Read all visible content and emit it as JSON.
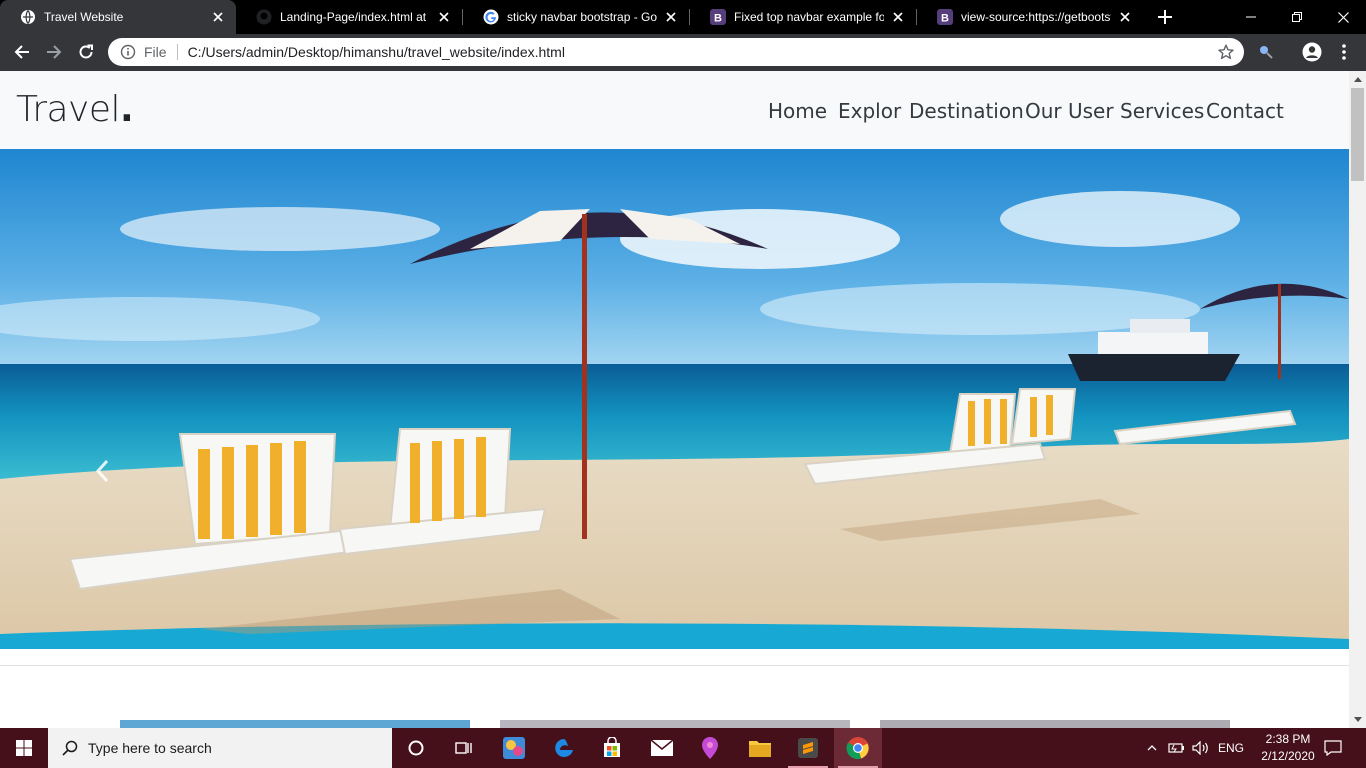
{
  "browser": {
    "tabs": [
      {
        "title": "Travel Website",
        "active": true,
        "favicon": "globe-icon"
      },
      {
        "title": "Landing-Page/index.html at m",
        "active": false,
        "favicon": "github-icon"
      },
      {
        "title": "sticky navbar bootstrap - Goog",
        "active": false,
        "favicon": "google-icon"
      },
      {
        "title": "Fixed top navbar example for B",
        "active": false,
        "favicon": "bootstrap-icon"
      },
      {
        "title": "view-source:https://getbootstr",
        "active": false,
        "favicon": "bootstrap-icon"
      }
    ],
    "address": {
      "scheme_label": "File",
      "url": "C:/Users/admin/Desktop/himanshu/travel_website/index.html"
    }
  },
  "page": {
    "brand": "Travel",
    "brand_dot": ".",
    "nav": [
      "Home",
      "Explor",
      "Destination",
      "Our User",
      "Services",
      "Contact"
    ]
  },
  "taskbar": {
    "search_placeholder": "Type here to search",
    "language": "ENG",
    "time": "2:38 PM",
    "date": "2/12/2020"
  },
  "colors": {
    "brand_bootstrap": "#563d7c",
    "taskbar": "#45101a",
    "sea": "#1ea7c9",
    "sand": "#eadcc4"
  }
}
